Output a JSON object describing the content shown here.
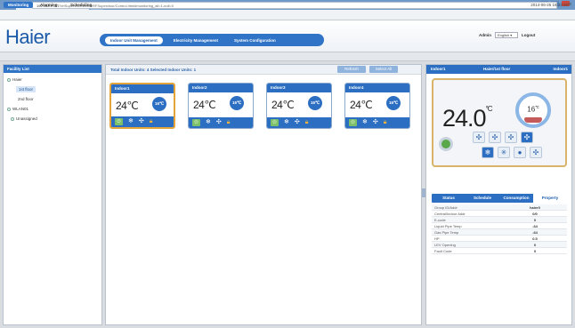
{
  "browser": {
    "tab_title": "Haier VRF Supervisor C...",
    "tab_close": "×",
    "url_host": "192.168.1.127",
    "url_path": "/VrfSupervisor/web/VRFSupervisor/Control.html#monitoring_all=1-null=0",
    "back_glyph": "←",
    "forward_glyph": "→",
    "reload_glyph": "C",
    "menu_glyph": "≡"
  },
  "header": {
    "logo": "Haier",
    "nav": [
      "Indoor Unit Management",
      "Electricity Management",
      "System Configuration"
    ],
    "user_label": "Admin",
    "language": "English",
    "logout": "Logout"
  },
  "subnav": {
    "items": [
      "Monitoring",
      "Alarming",
      "Scheduling"
    ],
    "datetime": "2014-06-25 16:23:45"
  },
  "left": {
    "title": "Facility List",
    "tree": [
      {
        "label": "Haier",
        "level": 0
      },
      {
        "label": "1st floor",
        "level": 2,
        "selected": true
      },
      {
        "label": "2nd floor",
        "level": 2
      },
      {
        "label": "WLAN01",
        "level": 0
      },
      {
        "label": "Unassigned",
        "level": 1
      }
    ]
  },
  "center": {
    "stats": "Total Indoor Units: 4   Selected Indoor Units: 1",
    "btn_refresh": "Refresh",
    "btn_select_all": "Select All",
    "units": [
      {
        "name": "Indoor1",
        "temp": "24℃",
        "setpoint": "16℃",
        "selected": true
      },
      {
        "name": "Indoor2",
        "temp": "24℃",
        "setpoint": "16℃",
        "selected": false
      },
      {
        "name": "Indoor3",
        "temp": "24℃",
        "setpoint": "16℃",
        "selected": false
      },
      {
        "name": "Indoor4",
        "temp": "24℃",
        "setpoint": "16℃",
        "selected": false
      }
    ]
  },
  "detail": {
    "unit": "Indoor1",
    "location": "Haier/1st floor",
    "unit_right": "Indoor1",
    "room_temp": "24.0",
    "room_temp_unit": "°C",
    "setpoint": "16",
    "setpoint_unit": "℃",
    "tabs": [
      "Status",
      "Schedule",
      "Consumption",
      "Property"
    ],
    "active_tab": "Property",
    "properties": [
      {
        "k": "Group ID/Addr",
        "v": "haier0"
      },
      {
        "k": "Central/Indoor Addr",
        "v": "0/0"
      },
      {
        "k": "E-code",
        "v": "0"
      },
      {
        "k": "Liquid Pipe Temp",
        "v": "-64"
      },
      {
        "k": "Gas Pipe Temp",
        "v": "-64"
      },
      {
        "k": "HP",
        "v": "0.5"
      },
      {
        "k": "LEV Opening",
        "v": "0"
      },
      {
        "k": "Fault Code",
        "v": "0"
      }
    ]
  },
  "colors": {
    "primary": "#2c6fc2",
    "selected_border": "#e3a43a",
    "power_on": "#5aa84a"
  }
}
